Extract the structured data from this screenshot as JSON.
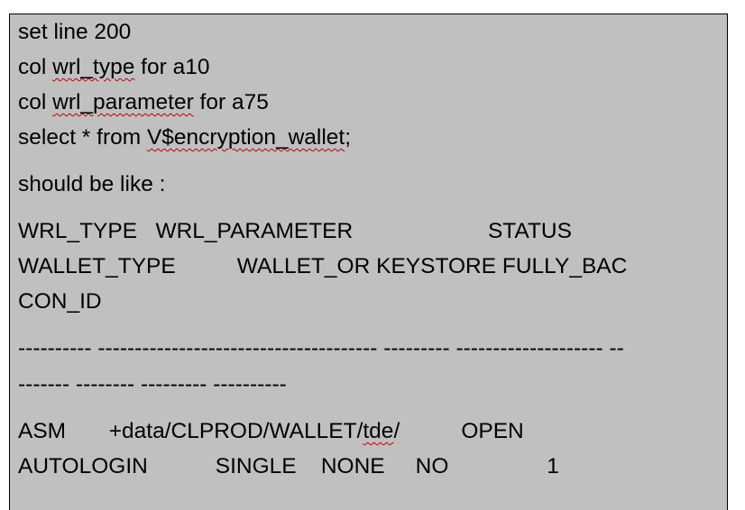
{
  "lines": {
    "l1": "set line 200",
    "l2_a": "col ",
    "l2_b": "wrl_type",
    "l2_c": " for a10",
    "l3_a": "col ",
    "l3_b": "wrl_parameter",
    "l3_c": " for a75",
    "l4_a": "select * from ",
    "l4_b": "V$encryption_wallet",
    "l4_c": ";",
    "l5": "should be like :",
    "l6": "WRL_TYPE   WRL_PARAMETER                      STATUS",
    "l7": "WALLET_TYPE          WALLET_OR KEYSTORE FULLY_BAC",
    "l8": "CON_ID",
    "l9": "---------- -------------------------------------- --------- -------------------- --",
    "l10": "------- -------- --------- ----------",
    "l11_a": "ASM       +data/CLPROD/WALLET/",
    "l11_b": "tde",
    "l11_c": "/          OPEN",
    "l12": "AUTOLOGIN           SINGLE    NONE     NO                1"
  }
}
